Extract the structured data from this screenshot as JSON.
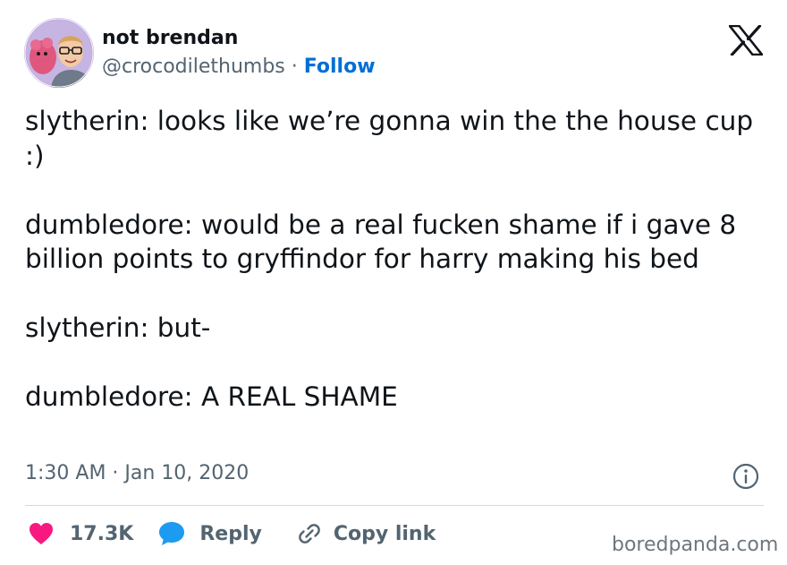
{
  "author": {
    "display_name": "not brendan",
    "handle": "@crocodilethumbs",
    "separator": " · ",
    "follow_label": "Follow"
  },
  "tweet": {
    "paragraphs": [
      "slytherin: looks like we’re gonna win the the house cup :)",
      "dumbledore: would be a real fucken shame if i gave 8 billion points to gryffindor for harry making his bed",
      "slytherin: but-",
      "dumbledore: A REAL SHAME"
    ],
    "timestamp": "1:30 AM · Jan 10, 2020"
  },
  "actions": {
    "like_count": "17.3K",
    "reply_label": "Reply",
    "copy_link_label": "Copy link"
  },
  "watermark": "boredpanda.com",
  "colors": {
    "text": "#0f1419",
    "secondary": "#536471",
    "follow": "#006fd6",
    "like": "#f91880",
    "reply": "#1d9bf0",
    "divider": "#cfd9de"
  },
  "icons": {
    "brand": "x-logo-icon",
    "info": "info-icon",
    "like": "heart-icon",
    "reply": "speech-bubble-icon",
    "copy_link": "link-icon"
  }
}
